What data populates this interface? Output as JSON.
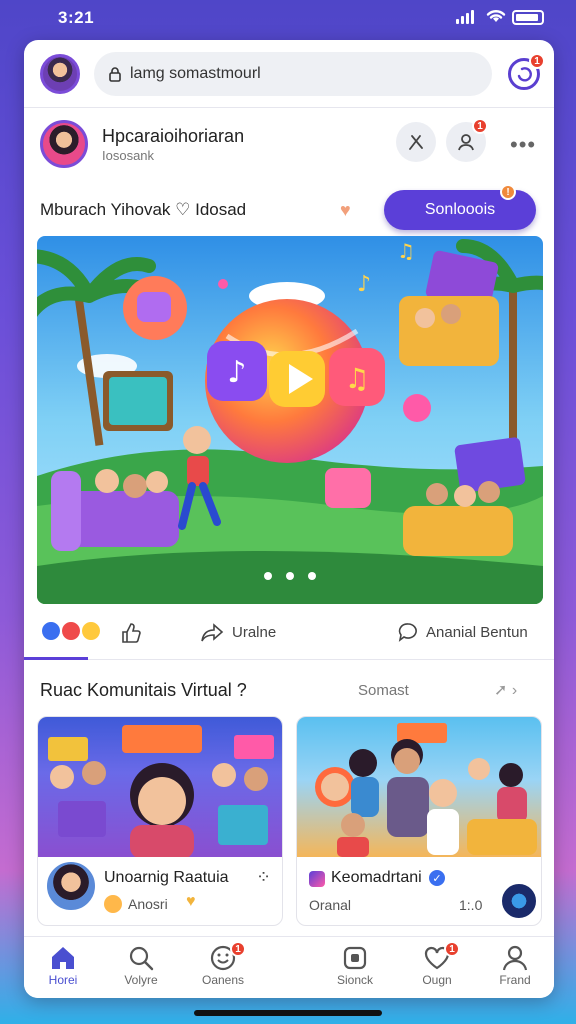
{
  "status": {
    "time": "3:21"
  },
  "search": {
    "placeholder": "lamg somastmourl"
  },
  "notifications": {
    "badge": "1"
  },
  "post": {
    "author": "Hpcaraioihoriaran",
    "subtitle": "Iososank",
    "badge": "1",
    "caption": "Mburach Yihovak ♡ Idosad",
    "primary_button": "Sonlooois",
    "primary_badge": "!"
  },
  "actions": {
    "share": "Uralne",
    "comment": "Ananial Bentun"
  },
  "section": {
    "title": "Ruac Komunitais Virtual ?",
    "link": "Somast"
  },
  "tiles": [
    {
      "title": "Unoarnig Raatuia",
      "subtitle": "Anosri"
    },
    {
      "title": "Keomadrtani",
      "subtitle": "Oranal",
      "meta": "1:.0"
    }
  ],
  "nav": [
    {
      "label": "Horei",
      "icon": "home-icon"
    },
    {
      "label": "Volyre",
      "icon": "search-icon"
    },
    {
      "label": "Oanens",
      "icon": "smile-icon",
      "badge": "1"
    },
    {
      "label": "Sionck",
      "icon": "media-icon"
    },
    {
      "label": "Ougn",
      "icon": "heart-chat-icon",
      "badge": "1"
    },
    {
      "label": "Frand",
      "icon": "person-icon"
    }
  ],
  "colors": {
    "accent": "#5b3fd8",
    "badge": "#e8402e",
    "nav_active": "#4a4fd0"
  }
}
